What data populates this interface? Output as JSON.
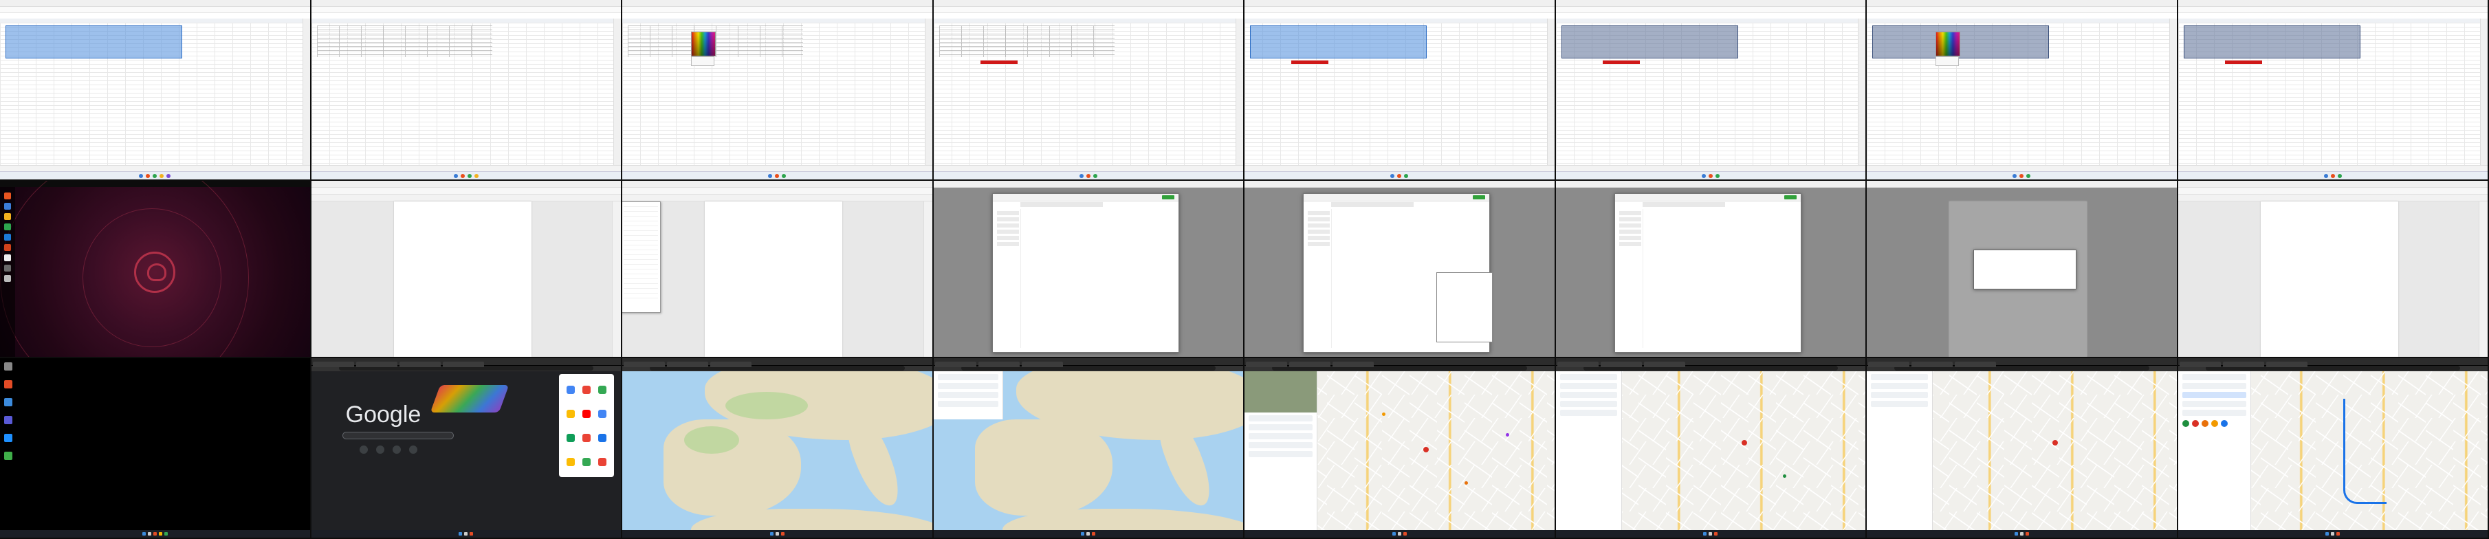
{
  "grid": {
    "rows": 3,
    "cols": 8
  },
  "calc": {
    "title": "",
    "menu": "",
    "sheet_tab": ""
  },
  "writer": {
    "heading": "",
    "body": ""
  },
  "google": {
    "logo": "Google"
  },
  "colors": {
    "calc_selection": "#2b6cc4",
    "red_fill": "#d01818",
    "ubuntu_bg": "#3a0d24",
    "sea": "#a9d2f0",
    "route": "#1a73e8"
  }
}
